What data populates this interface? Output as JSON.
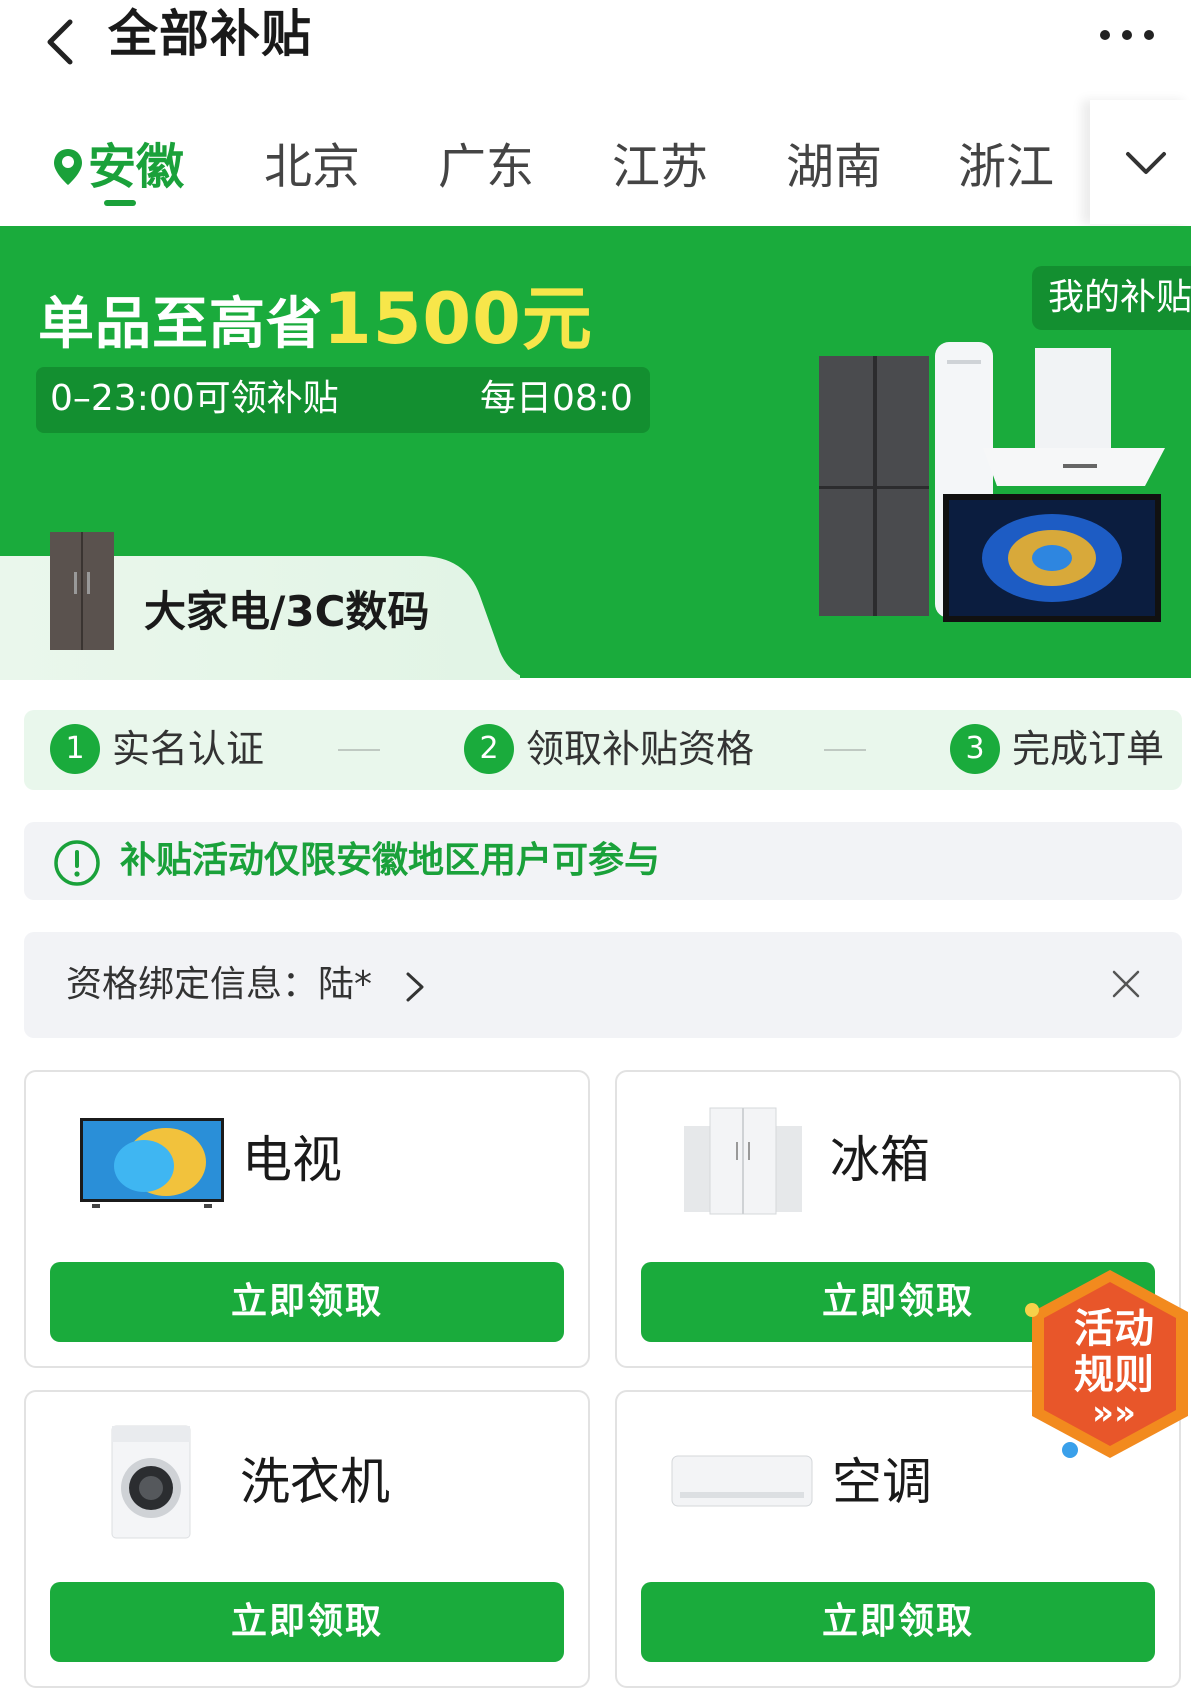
{
  "header": {
    "title": "全部补贴"
  },
  "regions": {
    "tabs": [
      "安徽",
      "北京",
      "广东",
      "江苏",
      "湖南",
      "浙江"
    ],
    "active": "安徽"
  },
  "banner": {
    "headline_text": "单品至高省",
    "headline_amount": "1500元",
    "time_left": "0–23:00可领补贴",
    "time_right": "每日08:0",
    "my_subsidy": "我的补贴",
    "category": "大家电/3C数码",
    "colors": {
      "brand_green": "#1aab3c",
      "dark_green": "#138f30",
      "highlight_yellow": "#f7e64a"
    }
  },
  "steps": [
    {
      "num": "1",
      "label": "实名认证"
    },
    {
      "num": "2",
      "label": "领取补贴资格"
    },
    {
      "num": "3",
      "label": "完成订单"
    }
  ],
  "notice": {
    "text": "补贴活动仅限安徽地区用户可参与",
    "icon": "info-circle-icon"
  },
  "binding": {
    "text": "资格绑定信息：陆*"
  },
  "products": [
    {
      "name": "电视",
      "button": "立即领取",
      "icon": "tv-icon"
    },
    {
      "name": "冰箱",
      "button": "立即领取",
      "icon": "fridge-icon"
    },
    {
      "name": "洗衣机",
      "button": "立即领取",
      "icon": "washer-icon"
    },
    {
      "name": "空调",
      "button": "立即领取",
      "icon": "air-conditioner-icon"
    }
  ],
  "rules_badge": {
    "line1": "活动",
    "line2": "规则",
    "arrows": "»»"
  }
}
